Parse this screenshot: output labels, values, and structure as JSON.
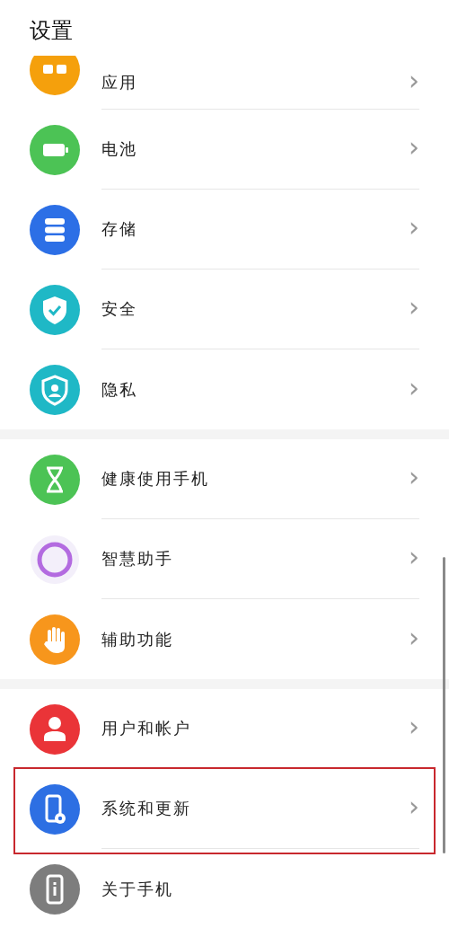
{
  "title": "设置",
  "groups": [
    {
      "items": [
        {
          "label": "应用",
          "kind": "apps",
          "color": "#f5a00c",
          "chevron": "›",
          "cut": true,
          "highlighted": false
        },
        {
          "label": "电池",
          "kind": "battery",
          "color": "#4cc355",
          "chevron": "›",
          "cut": false,
          "highlighted": false
        },
        {
          "label": "存储",
          "kind": "storage",
          "color": "#2c6fe6",
          "chevron": "›",
          "cut": false,
          "highlighted": false
        },
        {
          "label": "安全",
          "kind": "shield",
          "color": "#1fb8c6",
          "chevron": "›",
          "cut": false,
          "highlighted": false
        },
        {
          "label": "隐私",
          "kind": "privacy",
          "color": "#1fb8c6",
          "chevron": "›",
          "cut": false,
          "highlighted": false
        }
      ]
    },
    {
      "items": [
        {
          "label": "健康使用手机",
          "kind": "hourglass",
          "color": "#4cc355",
          "chevron": "›",
          "cut": false,
          "highlighted": false
        },
        {
          "label": "智慧助手",
          "kind": "ring",
          "color": "#b36be0",
          "chevron": "›",
          "cut": false,
          "highlighted": false
        },
        {
          "label": "辅助功能",
          "kind": "hand",
          "color": "#f7961c",
          "chevron": "›",
          "cut": false,
          "highlighted": false
        }
      ]
    },
    {
      "items": [
        {
          "label": "用户和帐户",
          "kind": "user",
          "color": "#ea3438",
          "chevron": "›",
          "cut": false,
          "highlighted": false
        },
        {
          "label": "系统和更新",
          "kind": "system",
          "color": "#2d6fe3",
          "chevron": "›",
          "cut": false,
          "highlighted": true
        },
        {
          "label": "关于手机",
          "kind": "about",
          "color": "#7d7d7d",
          "cut": false,
          "highlighted": false
        }
      ]
    }
  ]
}
